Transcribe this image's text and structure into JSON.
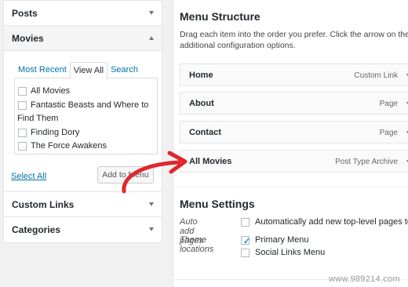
{
  "left": {
    "posts": {
      "title": "Posts"
    },
    "movies": {
      "title": "Movies",
      "tabs": [
        "Most Recent",
        "View All",
        "Search"
      ],
      "items": [
        "All Movies",
        "Fantastic Beasts and Where to",
        "Find Them",
        "Finding Dory",
        "The Force Awakens"
      ],
      "select_all": "Select All",
      "add_button": "Add to Menu"
    },
    "custom_links": {
      "title": "Custom Links"
    },
    "categories": {
      "title": "Categories"
    }
  },
  "right": {
    "structure_title": "Menu Structure",
    "desc_line1": "Drag each item into the order you prefer. Click the arrow on the rig",
    "desc_line2": "additional configuration options.",
    "menu_items": [
      {
        "title": "Home",
        "type": "Custom Link"
      },
      {
        "title": "About",
        "type": "Page"
      },
      {
        "title": "Contact",
        "type": "Page"
      },
      {
        "title": "All Movies",
        "type": "Post Type Archive"
      }
    ],
    "settings": {
      "title": "Menu Settings",
      "auto_add_label": "Auto add pages",
      "auto_add_option": "Automatically add new top-level pages to thi",
      "locations_label": "Theme locations",
      "primary": "Primary Menu",
      "primary_checked": true,
      "social": "Social Links Menu",
      "social_checked": false
    }
  },
  "watermark": "www.989214.com",
  "colors": {
    "link": "#0073aa",
    "arrow": "#e0262d"
  }
}
